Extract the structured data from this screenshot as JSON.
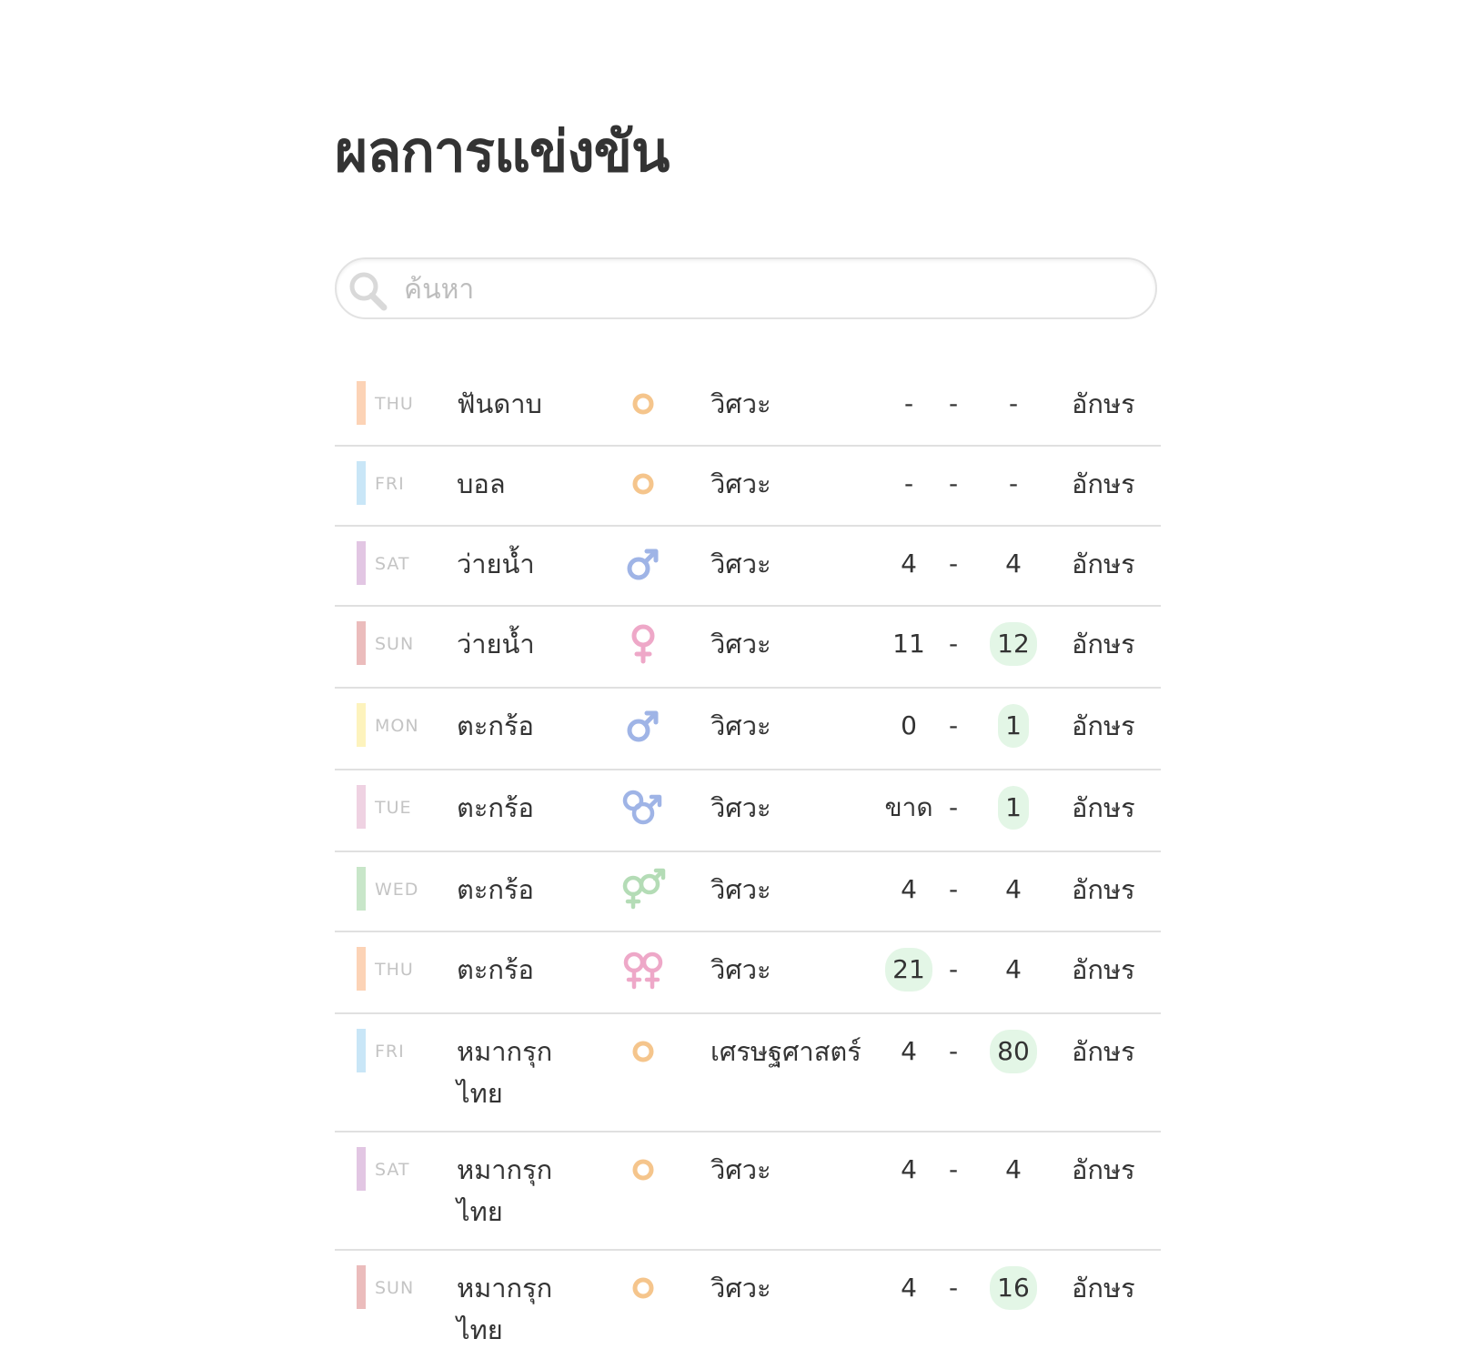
{
  "page": {
    "title": "ผลการแข่งขัน"
  },
  "search": {
    "placeholder": "ค้นหา",
    "value": ""
  },
  "colors": {
    "THU": "#fcd3b6",
    "FRI": "#c9e6f7",
    "SAT": "#e2c6e3",
    "SUN": "#ebbcbc",
    "MON": "#fdf3bd",
    "TUE": "#efd2e2",
    "WED": "#c8e6c9",
    "neutral_icon": "#f5c58c",
    "male_icon": "#9fb4e6",
    "female_icon": "#eea8c8",
    "mixed_icon": "#b4dcb6",
    "winner_bg": "#e3f6e6"
  },
  "rows": [
    {
      "day": "THU",
      "sport": "ฟันดาบ",
      "gender_icon": "neutral-icon",
      "faculty": "วิศวะ",
      "score_a": "-",
      "sep": "-",
      "score_b": "-",
      "winner": "none",
      "detail": "อักษร"
    },
    {
      "day": "FRI",
      "sport": "บอล",
      "gender_icon": "neutral-icon",
      "faculty": "วิศวะ",
      "score_a": "-",
      "sep": "-",
      "score_b": "-",
      "winner": "none",
      "detail": "อักษร"
    },
    {
      "day": "SAT",
      "sport": "ว่ายน้ำ",
      "gender_icon": "male-icon",
      "faculty": "วิศวะ",
      "score_a": "4",
      "sep": "-",
      "score_b": "4",
      "winner": "none",
      "detail": "อักษร"
    },
    {
      "day": "SUN",
      "sport": "ว่ายน้ำ",
      "gender_icon": "female-icon",
      "faculty": "วิศวะ",
      "score_a": "11",
      "sep": "-",
      "score_b": "12",
      "winner": "b",
      "detail": "อักษร"
    },
    {
      "day": "MON",
      "sport": "ตะกร้อ",
      "gender_icon": "male-icon",
      "faculty": "วิศวะ",
      "score_a": "0",
      "sep": "-",
      "score_b": "1",
      "winner": "b",
      "detail": "อักษร"
    },
    {
      "day": "TUE",
      "sport": "ตะกร้อ",
      "gender_icon": "double-male-icon",
      "faculty": "วิศวะ",
      "score_a": "ขาด",
      "sep": "-",
      "score_b": "1",
      "winner": "b",
      "detail": "อักษร"
    },
    {
      "day": "WED",
      "sport": "ตะกร้อ",
      "gender_icon": "mixed-gender-icon",
      "faculty": "วิศวะ",
      "score_a": "4",
      "sep": "-",
      "score_b": "4",
      "winner": "none",
      "detail": "อักษร"
    },
    {
      "day": "THU",
      "sport": "ตะกร้อ",
      "gender_icon": "double-female-icon",
      "faculty": "วิศวะ",
      "score_a": "21",
      "sep": "-",
      "score_b": "4",
      "winner": "a",
      "detail": "อักษร"
    },
    {
      "day": "FRI",
      "sport": "หมากรุก ไทย",
      "gender_icon": "neutral-icon",
      "faculty": "เศรษฐศาสตร์",
      "score_a": "4",
      "sep": "-",
      "score_b": "80",
      "winner": "b",
      "detail": "อักษร"
    },
    {
      "day": "SAT",
      "sport": "หมากรุก ไทย",
      "gender_icon": "neutral-icon",
      "faculty": "วิศวะ",
      "score_a": "4",
      "sep": "-",
      "score_b": "4",
      "winner": "none",
      "detail": "อักษร"
    },
    {
      "day": "SUN",
      "sport": "หมากรุก ไทย",
      "gender_icon": "neutral-icon",
      "faculty": "วิศวะ",
      "score_a": "4",
      "sep": "-",
      "score_b": "16",
      "winner": "b",
      "detail": "อักษร"
    }
  ]
}
